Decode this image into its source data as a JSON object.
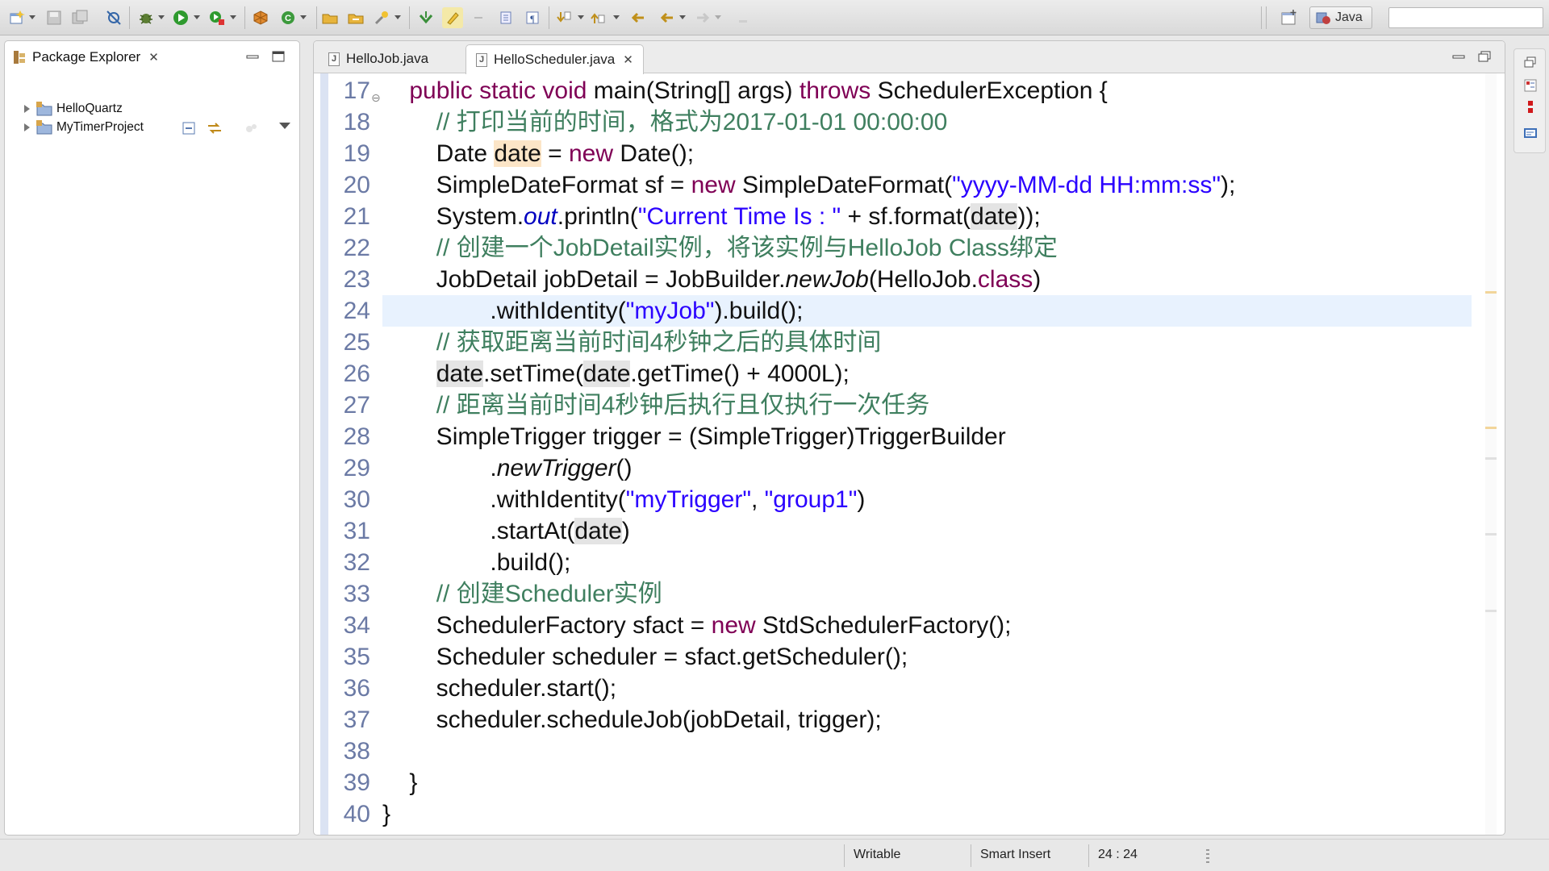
{
  "window": {
    "perspective": "Java",
    "quick_access_placeholder": ""
  },
  "toolbar": {
    "icons": [
      "new-icon",
      "save-icon",
      "save-all-icon",
      "skip-breakpoints-icon",
      "debug-icon",
      "run-icon",
      "run-external-icon",
      "new-java-project-icon",
      "new-java-class-icon",
      "open-type-icon",
      "open-task-icon",
      "search-icon",
      "next-annotation-icon",
      "toggle-highlight-icon",
      "toggle-block-selection-icon",
      "show-whitespace-icon",
      "next-edit-icon",
      "previous-edit-icon",
      "back-icon",
      "forward-icon",
      "pin-editor-icon",
      "open-perspective-icon"
    ]
  },
  "package_explorer": {
    "title": "Package Explorer",
    "projects": [
      {
        "name": "HelloQuartz"
      },
      {
        "name": "MyTimerProject"
      }
    ]
  },
  "editor": {
    "tabs": [
      {
        "label": "HelloJob.java",
        "active": false
      },
      {
        "label": "HelloScheduler.java",
        "active": true
      }
    ],
    "current_line": 24,
    "lines": [
      {
        "n": "17",
        "segs": [
          [
            "",
            "    "
          ],
          [
            "kw",
            "public static void"
          ],
          [
            "",
            " main(String[] args) "
          ],
          [
            "kw",
            "throws"
          ],
          [
            "",
            " SchedulerException {"
          ]
        ]
      },
      {
        "n": "18",
        "segs": [
          [
            "",
            "        "
          ],
          [
            "cm",
            "// 打印当前的时间，格式为2017-01-01 00:00:00"
          ]
        ]
      },
      {
        "n": "19",
        "segs": [
          [
            "",
            "        Date "
          ],
          [
            "hl",
            "date"
          ],
          [
            "",
            " = "
          ],
          [
            "kw",
            "new"
          ],
          [
            "",
            " Date();"
          ]
        ]
      },
      {
        "n": "20",
        "segs": [
          [
            "",
            "        SimpleDateFormat sf = "
          ],
          [
            "kw",
            "new"
          ],
          [
            "",
            " SimpleDateFormat("
          ],
          [
            "st",
            "\"yyyy-MM-dd HH:mm:ss\""
          ],
          [
            "",
            ");"
          ]
        ]
      },
      {
        "n": "21",
        "segs": [
          [
            "",
            "        System."
          ],
          [
            "fl",
            "out"
          ],
          [
            "",
            ".println("
          ],
          [
            "st",
            "\"Current Time Is : \""
          ],
          [
            "",
            " + sf.format("
          ],
          [
            "hlg",
            "date"
          ],
          [
            "",
            "));"
          ]
        ]
      },
      {
        "n": "22",
        "segs": [
          [
            "",
            "        "
          ],
          [
            "cm",
            "// 创建一个JobDetail实例，将该实例与HelloJob Class绑定"
          ]
        ]
      },
      {
        "n": "23",
        "segs": [
          [
            "",
            "        JobDetail jobDetail = JobBuilder."
          ],
          [
            "it",
            "newJob"
          ],
          [
            "",
            "(HelloJob."
          ],
          [
            "kw",
            "class"
          ],
          [
            "",
            ")"
          ]
        ]
      },
      {
        "n": "24",
        "segs": [
          [
            "",
            "                .withIdentity("
          ],
          [
            "st",
            "\"myJob\""
          ],
          [
            "",
            ").build();"
          ]
        ]
      },
      {
        "n": "25",
        "segs": [
          [
            "",
            "        "
          ],
          [
            "cm",
            "// 获取距离当前时间4秒钟之后的具体时间"
          ]
        ]
      },
      {
        "n": "26",
        "segs": [
          [
            "",
            "        "
          ],
          [
            "hlg",
            "date"
          ],
          [
            "",
            ".setTime("
          ],
          [
            "hlg",
            "date"
          ],
          [
            "",
            ".getTime() + 4000L);"
          ]
        ]
      },
      {
        "n": "27",
        "segs": [
          [
            "",
            "        "
          ],
          [
            "cm",
            "// 距离当前时间4秒钟后执行且仅执行一次任务"
          ]
        ]
      },
      {
        "n": "28",
        "segs": [
          [
            "",
            "        SimpleTrigger trigger = (SimpleTrigger)TriggerBuilder"
          ]
        ]
      },
      {
        "n": "29",
        "segs": [
          [
            "",
            "                ."
          ],
          [
            "it",
            "newTrigger"
          ],
          [
            "",
            "()"
          ]
        ]
      },
      {
        "n": "30",
        "segs": [
          [
            "",
            "                .withIdentity("
          ],
          [
            "st",
            "\"myTrigger\""
          ],
          [
            "",
            ", "
          ],
          [
            "st",
            "\"group1\""
          ],
          [
            "",
            ")"
          ]
        ]
      },
      {
        "n": "31",
        "segs": [
          [
            "",
            "                .startAt("
          ],
          [
            "hlg",
            "date"
          ],
          [
            "",
            ")"
          ]
        ]
      },
      {
        "n": "32",
        "segs": [
          [
            "",
            "                .build();"
          ]
        ]
      },
      {
        "n": "33",
        "segs": [
          [
            "",
            "        "
          ],
          [
            "cm",
            "// 创建Scheduler实例"
          ]
        ]
      },
      {
        "n": "34",
        "segs": [
          [
            "",
            "        SchedulerFactory sfact = "
          ],
          [
            "kw",
            "new"
          ],
          [
            "",
            " StdSchedulerFactory();"
          ]
        ]
      },
      {
        "n": "35",
        "segs": [
          [
            "",
            "        Scheduler scheduler = sfact.getScheduler();"
          ]
        ]
      },
      {
        "n": "36",
        "segs": [
          [
            "",
            "        scheduler.start();"
          ]
        ]
      },
      {
        "n": "37",
        "segs": [
          [
            "",
            "        scheduler.scheduleJob(jobDetail, trigger);"
          ]
        ]
      },
      {
        "n": "38",
        "segs": [
          [
            "",
            ""
          ]
        ]
      },
      {
        "n": "39",
        "segs": [
          [
            "",
            "    }"
          ]
        ]
      },
      {
        "n": "40",
        "segs": [
          [
            "",
            "}"
          ]
        ]
      }
    ]
  },
  "status_bar": {
    "mode": "Writable",
    "insert_mode": "Smart Insert",
    "position": "24 : 24"
  },
  "colors": {
    "keyword": "#7f0055",
    "comment": "#3f7f5f",
    "string": "#2a00ff",
    "line_number": "#6b7aa5",
    "current_line": "#e8f2fe"
  }
}
